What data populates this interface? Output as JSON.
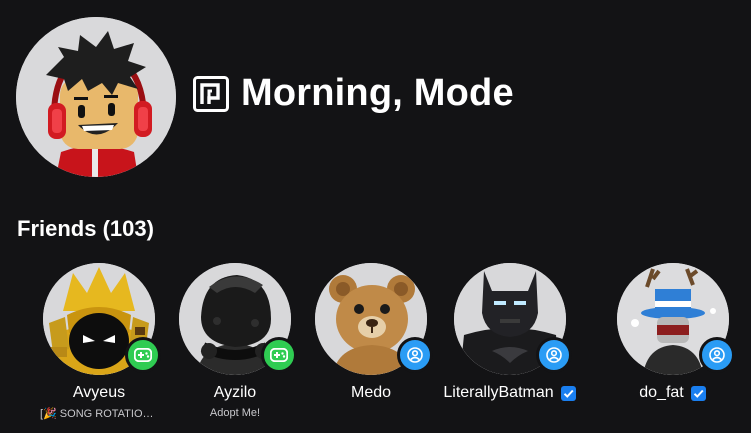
{
  "profile": {
    "display_name": "Morning, Mode",
    "premium_icon": "premium-icon",
    "accent": "#ffffff"
  },
  "friends": {
    "heading": "Friends (103)",
    "items": [
      {
        "name": "Avyeus",
        "status": "[🎉 SONG ROTATION...",
        "presence": "in-game",
        "verified": false
      },
      {
        "name": "Ayzilo",
        "status": "Adopt Me!",
        "presence": "in-game",
        "verified": false
      },
      {
        "name": "Medo",
        "status": "",
        "presence": "online",
        "verified": false
      },
      {
        "name": "LiterallyBatman",
        "status": "",
        "presence": "online",
        "verified": true
      },
      {
        "name": "do_fat",
        "status": "",
        "presence": "online",
        "verified": true
      }
    ]
  },
  "colors": {
    "background": "#131315",
    "in_game": "#2fcc52",
    "online": "#2a9cf5",
    "verified": "#1a7ff0"
  }
}
